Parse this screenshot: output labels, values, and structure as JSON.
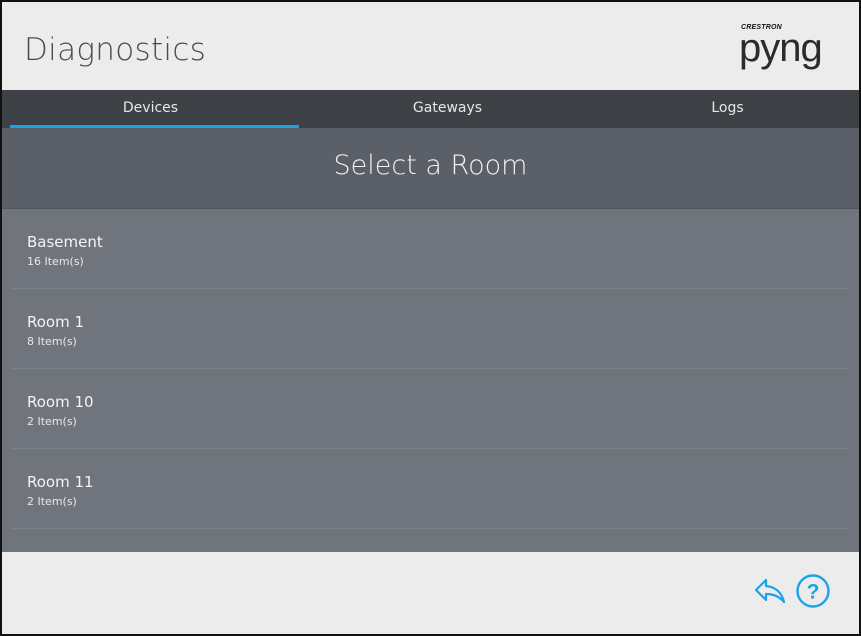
{
  "header": {
    "title": "Diagnostics",
    "logo_brand": "CRESTRON",
    "logo_text": "pyng"
  },
  "tabs": [
    {
      "label": "Devices",
      "active": true
    },
    {
      "label": "Gateways",
      "active": false
    },
    {
      "label": "Logs",
      "active": false
    }
  ],
  "room_panel": {
    "heading": "Select a Room"
  },
  "rooms": [
    {
      "name": "Basement",
      "count": "16 Item(s)"
    },
    {
      "name": "Room 1",
      "count": "8 Item(s)"
    },
    {
      "name": "Room 10",
      "count": "2 Item(s)"
    },
    {
      "name": "Room 11",
      "count": "2 Item(s)"
    }
  ],
  "footer": {
    "back_icon": "back-arrow-icon",
    "help_icon": "help-question-icon"
  },
  "colors": {
    "accent": "#1aa3e8",
    "tab_bar": "#3e4247",
    "list_bg": "#70757d",
    "header_bg": "#5b6068"
  }
}
